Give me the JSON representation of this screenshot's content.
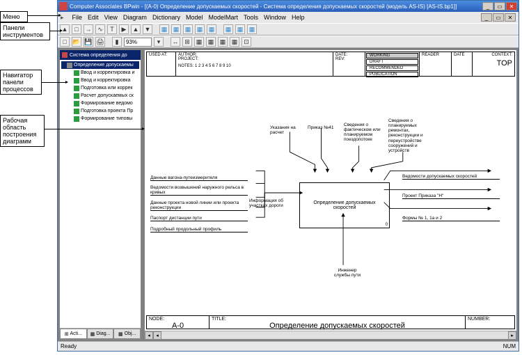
{
  "callouts": {
    "menu": "Меню",
    "toolbars": "Панели инструментов",
    "navigator": "Навигатор панели процессов",
    "workarea": "Рабочая область построения диаграмм"
  },
  "titlebar": "Computer Associates BPwin - [(A-0) Определение допускаемых скоростей - Система определения допускаемых скоростей (модель AS-IS)   [AS-IS.bp1]]",
  "menu": [
    "File",
    "Edit",
    "View",
    "Diagram",
    "Dictionary",
    "Model",
    "ModelMart",
    "Tools",
    "Window",
    "Help"
  ],
  "zoom": "93%",
  "sidebar": {
    "title": "Система определения до",
    "root_sel": "Определение допускаемы",
    "items": [
      "Ввод и корректировка и",
      "Ввод и корректировка",
      "Подготовка или коррек",
      "Расчет допускаемых ск",
      "Формирование ведомо",
      "Подготовка проекта Пр",
      "Формирование типовы"
    ],
    "tabs": [
      "Acti...",
      "Diag...",
      "Obj..."
    ]
  },
  "header": {
    "used_at": "USED AT:",
    "author": "AUTHOR:",
    "project": "PROJECT:",
    "date": "DATE:",
    "rev": "REV:",
    "notes": "NOTES: 1 2 3 4 5 6 7 8 9 10",
    "working": "WORKING",
    "draft": "DRAFT",
    "recommended": "RECOMMENDED",
    "publication": "PUBLICATION",
    "reader": "READER",
    "hdate": "DATE",
    "context": "CONTEXT:",
    "top": "TOP"
  },
  "diagram": {
    "process": "Определение допускаемых скоростей",
    "inputs_label": "Информация об участках дороги",
    "inputs": [
      "Данные вагона-путеизмерителя",
      "Ведомости возвышений наружного рельса в кривых",
      "Данные проекта новой линии или проекта реконструкции",
      "Паспорт дистанции пути",
      "Подробный продольный профиль"
    ],
    "controls": [
      "Указания на расчет",
      "Приказ №41",
      "Сведения о фактическом или планируемом поездопотоке",
      "Сведения о планируемых ремонтах, реконструкции и переустройстве сооружений и устройств"
    ],
    "outputs": [
      "Ведомости допускаемых скоростей",
      "Проект Приказа \"Н\"",
      "Формы № 1, 1а и 2"
    ],
    "mechanism": "Инженер службы пути"
  },
  "footer": {
    "node_lbl": "NODE:",
    "node": "A-0",
    "title_lbl": "TITLE:",
    "title": "Определение допускаемых скоростей",
    "number_lbl": "NUMBER:"
  },
  "status": {
    "ready": "Ready",
    "num": "NUM"
  }
}
